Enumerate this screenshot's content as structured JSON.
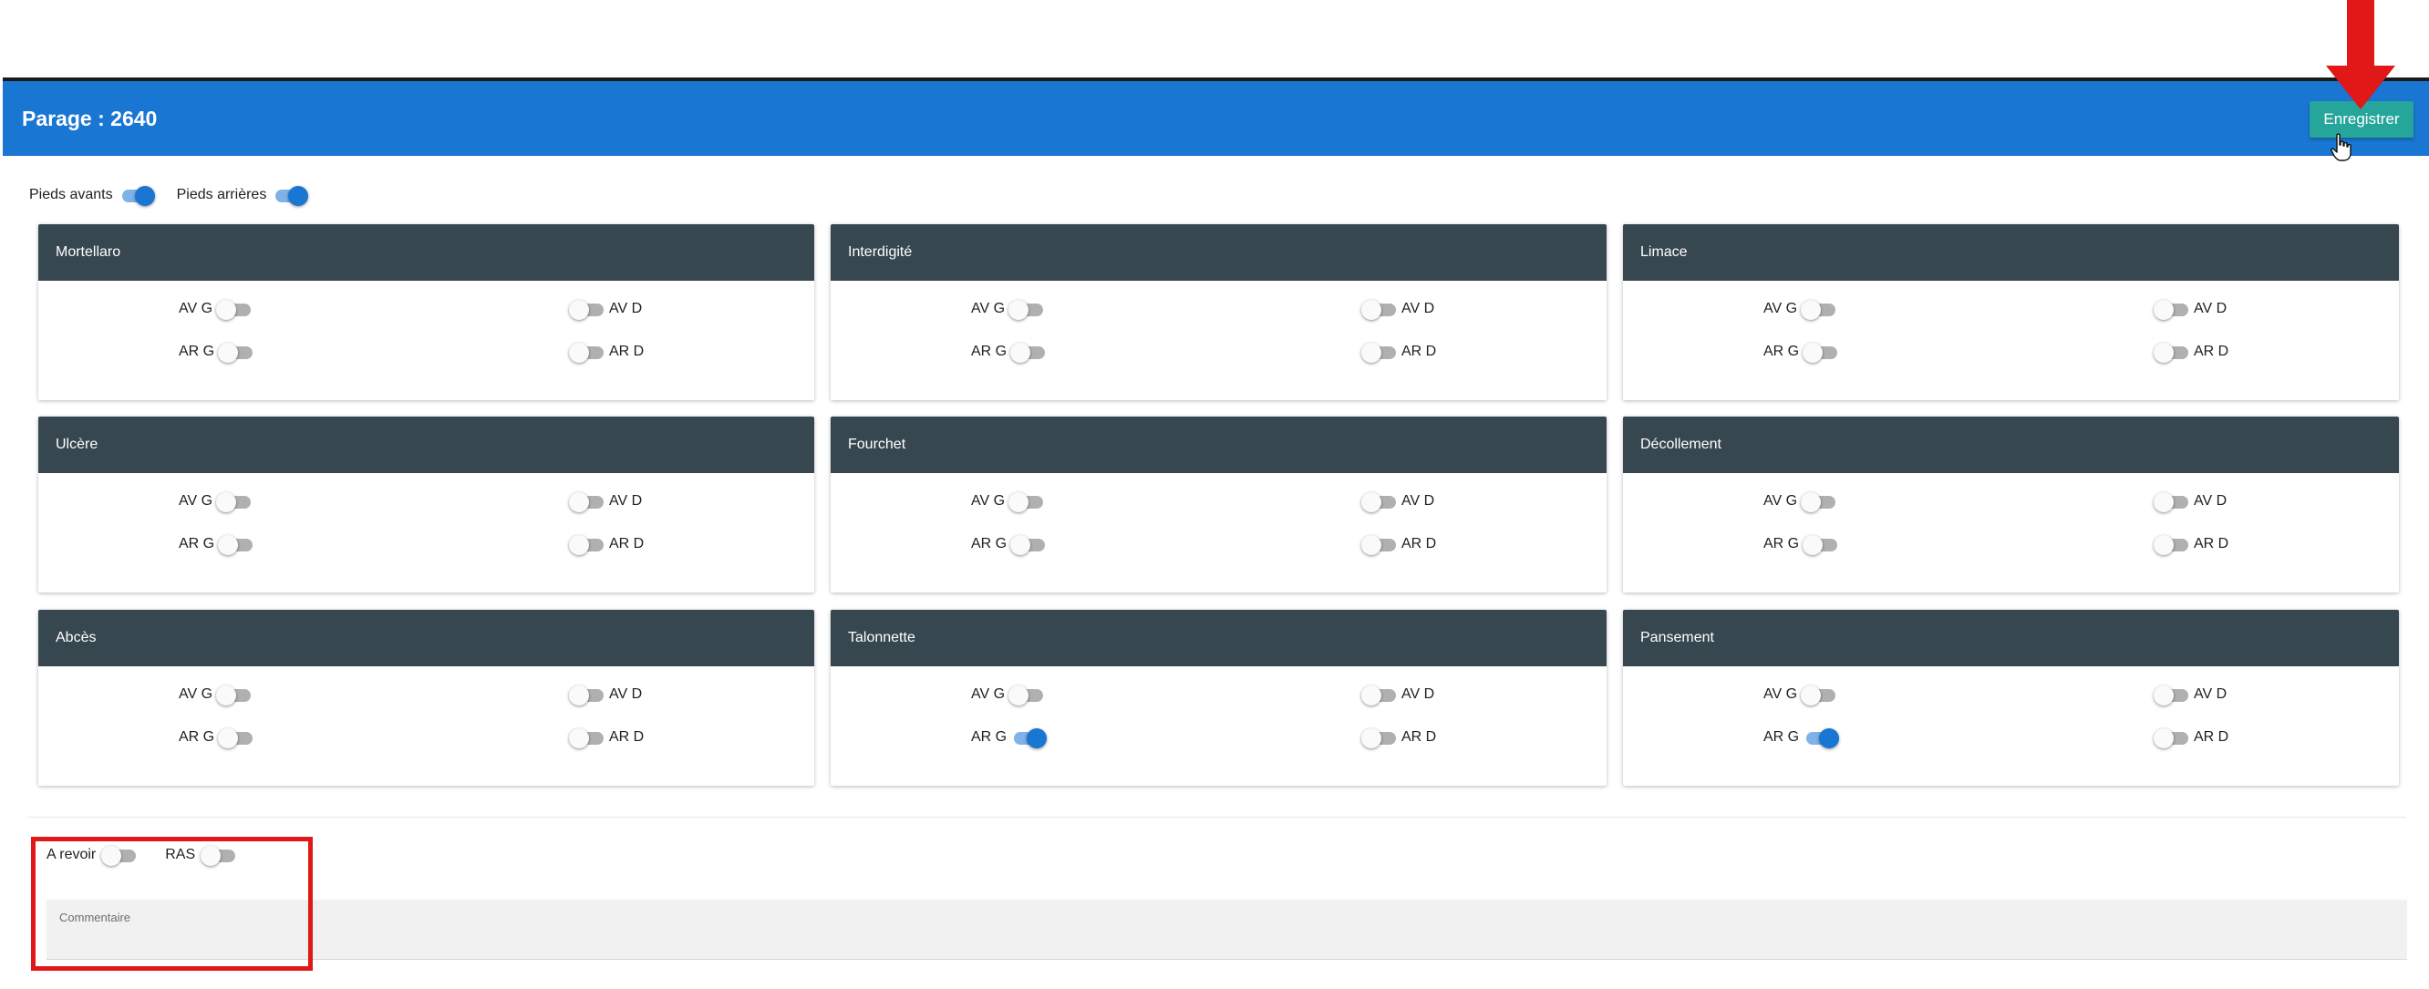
{
  "header": {
    "title": "Parage : 2640",
    "save_label": "Enregistrer"
  },
  "feet_toggles": [
    {
      "label": "Pieds avants",
      "on": true
    },
    {
      "label": "Pieds arrières",
      "on": true
    }
  ],
  "cards": [
    {
      "title": "Mortellaro",
      "av_g": false,
      "av_d": false,
      "ar_g": false,
      "ar_d": false
    },
    {
      "title": "Interdigité",
      "av_g": false,
      "av_d": false,
      "ar_g": false,
      "ar_d": false
    },
    {
      "title": "Limace",
      "av_g": false,
      "av_d": false,
      "ar_g": false,
      "ar_d": false
    },
    {
      "title": "Ulcère",
      "av_g": false,
      "av_d": false,
      "ar_g": false,
      "ar_d": false
    },
    {
      "title": "Fourchet",
      "av_g": false,
      "av_d": false,
      "ar_g": false,
      "ar_d": false
    },
    {
      "title": "Décollement",
      "av_g": false,
      "av_d": false,
      "ar_g": false,
      "ar_d": false
    },
    {
      "title": "Abcès",
      "av_g": false,
      "av_d": false,
      "ar_g": false,
      "ar_d": false
    },
    {
      "title": "Talonnette",
      "av_g": false,
      "av_d": false,
      "ar_g": true,
      "ar_d": false
    },
    {
      "title": "Pansement",
      "av_g": false,
      "av_d": false,
      "ar_g": true,
      "ar_d": false
    }
  ],
  "position_labels": {
    "av_g": "AV G",
    "av_d": "AV D",
    "ar_g": "AR G",
    "ar_d": "AR D"
  },
  "bottom_toggles": [
    {
      "label": "A revoir",
      "on": false
    },
    {
      "label": "RAS",
      "on": false
    }
  ],
  "comment": {
    "label": "Commentaire",
    "value": ""
  },
  "colors": {
    "header_bg": "#1976d2",
    "card_header_bg": "#37474f",
    "save_button_bg": "#26a69a",
    "switch_on": "#1976d2",
    "annotation_red": "#e01818"
  },
  "icons": {
    "cursor": "hand-pointer-icon",
    "annotation_arrow": "arrow-down-icon"
  }
}
